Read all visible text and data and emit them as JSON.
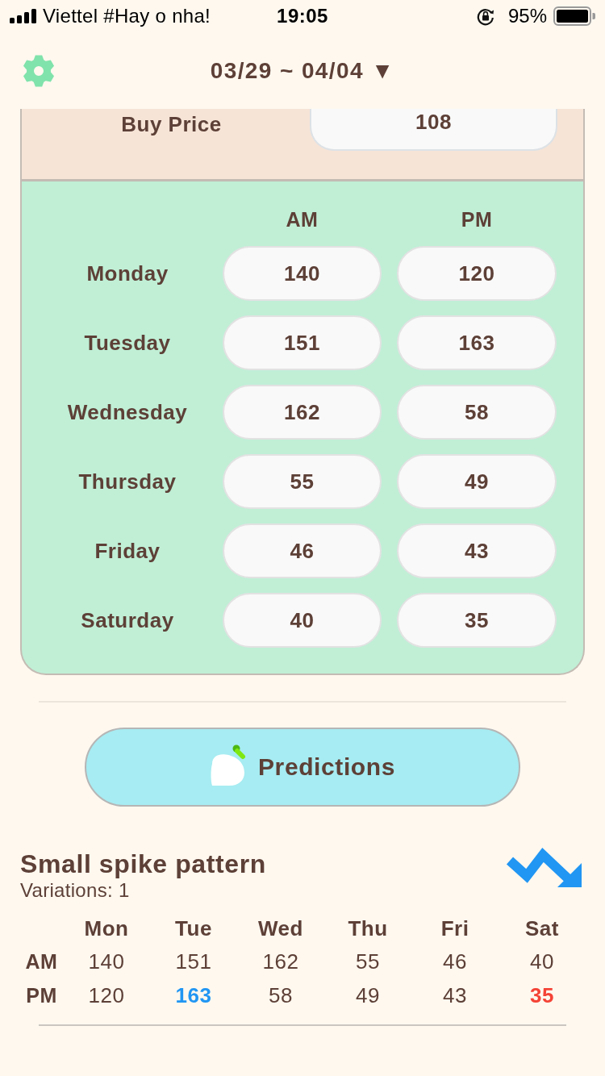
{
  "status_bar": {
    "carrier": "Viettel #Hay o nha!",
    "time": "19:05",
    "battery": "95%"
  },
  "header": {
    "week": "03/29 ~ 04/04 ▼"
  },
  "buy_price": {
    "label": "Buy Price",
    "value": "108"
  },
  "prices": {
    "columns": [
      "AM",
      "PM"
    ],
    "rows": [
      {
        "day": "Monday",
        "am": "140",
        "pm": "120"
      },
      {
        "day": "Tuesday",
        "am": "151",
        "pm": "163"
      },
      {
        "day": "Wednesday",
        "am": "162",
        "pm": "58"
      },
      {
        "day": "Thursday",
        "am": "55",
        "pm": "49"
      },
      {
        "day": "Friday",
        "am": "46",
        "pm": "43"
      },
      {
        "day": "Saturday",
        "am": "40",
        "pm": "35"
      }
    ]
  },
  "predictions_button": {
    "label": "Predictions"
  },
  "pattern": {
    "title": "Small spike pattern",
    "variations": "Variations: 1",
    "columns": [
      "Mon",
      "Tue",
      "Wed",
      "Thu",
      "Fri",
      "Sat"
    ],
    "rows": [
      {
        "label": "AM",
        "cells": [
          {
            "value": "140",
            "max": false,
            "min": false
          },
          {
            "value": "151",
            "max": false,
            "min": false
          },
          {
            "value": "162",
            "max": false,
            "min": false
          },
          {
            "value": "55",
            "max": false,
            "min": false
          },
          {
            "value": "46",
            "max": false,
            "min": false
          },
          {
            "value": "40",
            "max": false,
            "min": false
          }
        ]
      },
      {
        "label": "PM",
        "cells": [
          {
            "value": "120",
            "max": false,
            "min": false
          },
          {
            "value": "163",
            "max": true,
            "min": false
          },
          {
            "value": "58",
            "max": false,
            "min": false
          },
          {
            "value": "49",
            "max": false,
            "min": false
          },
          {
            "value": "43",
            "max": false,
            "min": false
          },
          {
            "value": "35",
            "max": false,
            "min": true
          }
        ]
      }
    ]
  }
}
